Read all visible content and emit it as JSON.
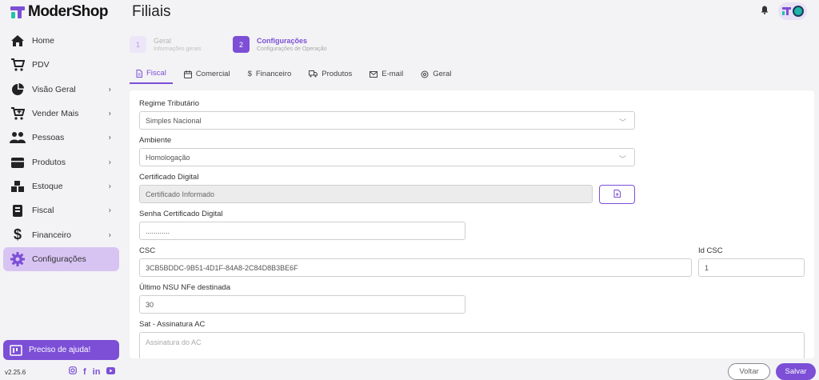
{
  "app": {
    "brand": "ModerShop",
    "page_title": "Filiais",
    "version": "v2.25.6",
    "accent_color": "#7c4fd6",
    "secondary_color": "#22c4a8"
  },
  "sidebar": {
    "items": [
      {
        "label": "Home",
        "icon": "home-icon",
        "has_chevron": false
      },
      {
        "label": "PDV",
        "icon": "cart-icon",
        "has_chevron": false
      },
      {
        "label": "Visão Geral",
        "icon": "pie-chart-icon",
        "has_chevron": true
      },
      {
        "label": "Vender Mais",
        "icon": "cart-plus-icon",
        "has_chevron": true
      },
      {
        "label": "Pessoas",
        "icon": "people-icon",
        "has_chevron": true
      },
      {
        "label": "Produtos",
        "icon": "box-icon",
        "has_chevron": true
      },
      {
        "label": "Estoque",
        "icon": "boxes-icon",
        "has_chevron": true
      },
      {
        "label": "Fiscal",
        "icon": "document-icon",
        "has_chevron": true
      },
      {
        "label": "Financeiro",
        "icon": "dollar-icon",
        "has_chevron": true
      },
      {
        "label": "Configurações",
        "icon": "gear-icon",
        "has_chevron": false,
        "active": true
      }
    ],
    "help_label": "Preciso de ajuda!",
    "social_icons": [
      "instagram-icon",
      "facebook-icon",
      "linkedin-icon",
      "youtube-icon"
    ]
  },
  "stepper": {
    "steps": [
      {
        "number": "1",
        "title": "Geral",
        "subtitle": "Informações gerais",
        "active": false
      },
      {
        "number": "2",
        "title": "Configurações",
        "subtitle": "Configurações de Operação",
        "active": true
      }
    ]
  },
  "tabs": [
    {
      "label": "Fiscal",
      "icon": "file-icon",
      "active": true
    },
    {
      "label": "Comercial",
      "icon": "calendar-icon",
      "active": false
    },
    {
      "label": "Financeiro",
      "icon": "dollar-small-icon",
      "active": false
    },
    {
      "label": "Produtos",
      "icon": "truck-icon",
      "active": false
    },
    {
      "label": "E-mail",
      "icon": "mail-icon",
      "active": false
    },
    {
      "label": "Geral",
      "icon": "settings-icon",
      "active": false
    }
  ],
  "form": {
    "regime": {
      "label": "Regime Tributário",
      "value": "Simples Nacional"
    },
    "ambiente": {
      "label": "Ambiente",
      "value": "Homologação"
    },
    "certificado": {
      "label": "Certificado Digital",
      "value": "Certificado Informado"
    },
    "senha": {
      "label": "Senha Certificado Digital",
      "value": "............"
    },
    "csc": {
      "label": "CSC",
      "value": "3CB5BDDC-9B51-4D1F-84A8-2C84D8B3BE6F"
    },
    "id_csc": {
      "label": "Id CSC",
      "value": "1"
    },
    "nsu": {
      "label": "Último NSU NFe destinada",
      "value": "30"
    },
    "sat": {
      "label": "Sat - Assinatura AC",
      "placeholder": "Assinatura do AC"
    }
  },
  "actions": {
    "back_label": "Voltar",
    "save_label": "Salvar"
  }
}
